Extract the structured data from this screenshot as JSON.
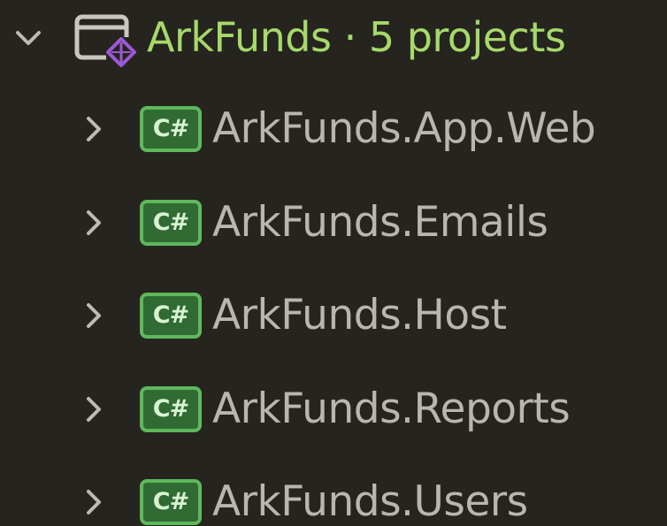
{
  "solution": {
    "name": "ArkFunds",
    "separator": "·",
    "summary": "5 projects",
    "expanded": true,
    "icon": "solution-icon"
  },
  "projects": [
    {
      "name": "ArkFunds.App.Web",
      "badge": "C#",
      "expanded": false
    },
    {
      "name": "ArkFunds.Emails",
      "badge": "C#",
      "expanded": false
    },
    {
      "name": "ArkFunds.Host",
      "badge": "C#",
      "expanded": false
    },
    {
      "name": "ArkFunds.Reports",
      "badge": "C#",
      "expanded": false
    },
    {
      "name": "ArkFunds.Users",
      "badge": "C#",
      "expanded": false
    }
  ],
  "colors": {
    "background": "#26241f",
    "solution_text": "#a6d96a",
    "project_text": "#b8b6b0",
    "csharp_badge": "#2f6b33",
    "csharp_border": "#5fb85c",
    "solution_accent": "#9b59d6"
  }
}
